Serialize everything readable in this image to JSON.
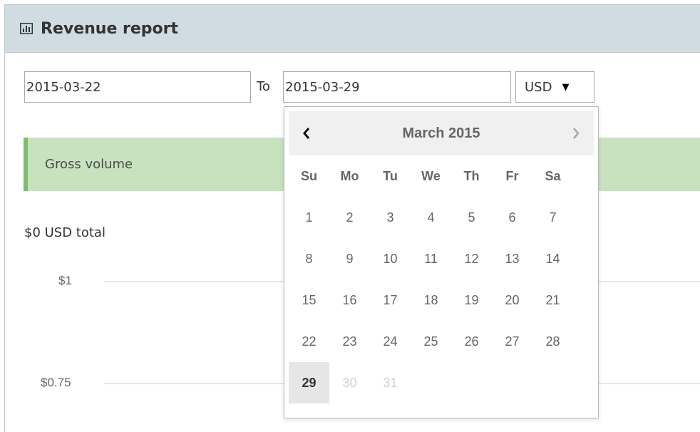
{
  "header": {
    "title": "Revenue report",
    "icon": "bar-chart-icon"
  },
  "filters": {
    "from_date": "2015-03-22",
    "to_label": "To",
    "to_date": "2015-03-29",
    "currency": "USD",
    "currency_options": [
      "USD"
    ]
  },
  "gross": {
    "label": "Gross volume",
    "total": "$0 USD total"
  },
  "chart": {
    "y_ticks": [
      "$1",
      "$0.75"
    ]
  },
  "datepicker": {
    "title": "March 2015",
    "prev": "‹",
    "next": "›",
    "weekdays": [
      "Su",
      "Mo",
      "Tu",
      "We",
      "Th",
      "Fr",
      "Sa"
    ],
    "days": [
      {
        "label": "1",
        "state": "normal"
      },
      {
        "label": "2",
        "state": "normal"
      },
      {
        "label": "3",
        "state": "normal"
      },
      {
        "label": "4",
        "state": "normal"
      },
      {
        "label": "5",
        "state": "normal"
      },
      {
        "label": "6",
        "state": "normal"
      },
      {
        "label": "7",
        "state": "normal"
      },
      {
        "label": "8",
        "state": "normal"
      },
      {
        "label": "9",
        "state": "normal"
      },
      {
        "label": "10",
        "state": "normal"
      },
      {
        "label": "11",
        "state": "normal"
      },
      {
        "label": "12",
        "state": "normal"
      },
      {
        "label": "13",
        "state": "normal"
      },
      {
        "label": "14",
        "state": "normal"
      },
      {
        "label": "15",
        "state": "normal"
      },
      {
        "label": "16",
        "state": "normal"
      },
      {
        "label": "17",
        "state": "normal"
      },
      {
        "label": "18",
        "state": "normal"
      },
      {
        "label": "19",
        "state": "normal"
      },
      {
        "label": "20",
        "state": "normal"
      },
      {
        "label": "21",
        "state": "normal"
      },
      {
        "label": "22",
        "state": "normal"
      },
      {
        "label": "23",
        "state": "normal"
      },
      {
        "label": "24",
        "state": "normal"
      },
      {
        "label": "25",
        "state": "normal"
      },
      {
        "label": "26",
        "state": "normal"
      },
      {
        "label": "27",
        "state": "normal"
      },
      {
        "label": "28",
        "state": "normal"
      },
      {
        "label": "29",
        "state": "selected"
      },
      {
        "label": "30",
        "state": "disabled"
      },
      {
        "label": "31",
        "state": "disabled"
      }
    ]
  },
  "colors": {
    "header_bg": "#cfdde3",
    "gross_bg": "#c8e2c0",
    "gross_accent": "#7cbe6c",
    "selected_day_bg": "#e6e6e6"
  }
}
